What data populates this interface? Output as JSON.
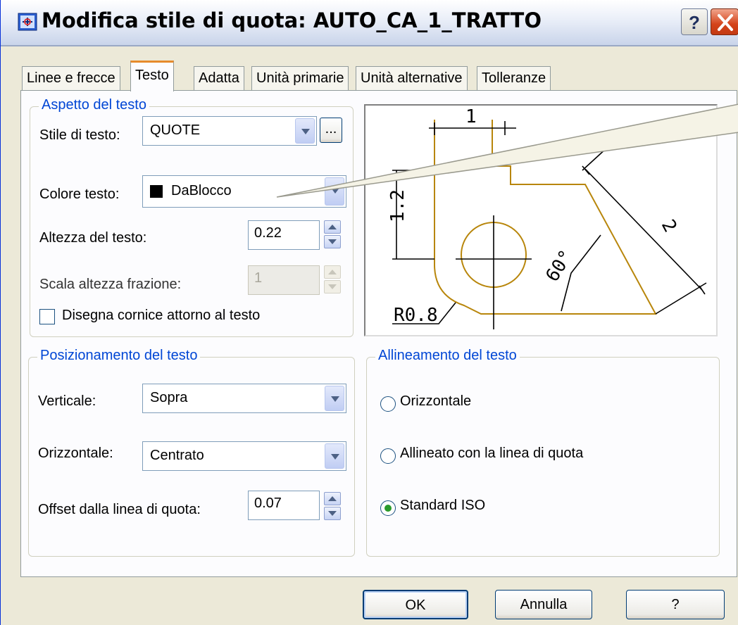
{
  "window": {
    "title": "Modifica stile di quota: AUTO_CA_1_TRATTO",
    "help_button": "?"
  },
  "tabs": [
    {
      "label": "Linee e frecce"
    },
    {
      "label": "Testo"
    },
    {
      "label": "Adatta"
    },
    {
      "label": "Unità primarie"
    },
    {
      "label": "Unità alternative"
    },
    {
      "label": "Tolleranze"
    }
  ],
  "aspetto": {
    "group_title": "Aspetto del testo",
    "stile_label": "Stile di testo:",
    "stile_value": "QUOTE",
    "browse_label": "...",
    "colore_label": "Colore testo:",
    "colore_value": "DaBlocco",
    "altezza_label": "Altezza del testo:",
    "altezza_value": "0.22",
    "scala_label": "Scala altezza frazione:",
    "scala_value": "1",
    "cornice_label": "Disegna cornice attorno al testo"
  },
  "posizionamento": {
    "group_title": "Posizionamento del testo",
    "verticale_label": "Verticale:",
    "verticale_value": "Sopra",
    "orizzontale_label": "Orizzontale:",
    "orizzontale_value": "Centrato",
    "offset_label": "Offset dalla linea di quota:",
    "offset_value": "0.07"
  },
  "allineamento": {
    "group_title": "Allineamento del testo",
    "options": [
      {
        "label": "Orizzontale",
        "checked": false
      },
      {
        "label": "Allineato con la linea di quota",
        "checked": false
      },
      {
        "label": "Standard ISO",
        "checked": true
      }
    ]
  },
  "preview": {
    "dim_top": "1",
    "dim_left": "1.2",
    "dim_diag": "2",
    "dim_angle": "60°",
    "dim_radius": "R0.8"
  },
  "buttons": {
    "ok": "OK",
    "cancel": "Annulla",
    "help": "?"
  },
  "colors": {
    "geometry": "#b8860b",
    "group_title": "#0046d5",
    "tab_active_accent": "#e68b2c"
  }
}
